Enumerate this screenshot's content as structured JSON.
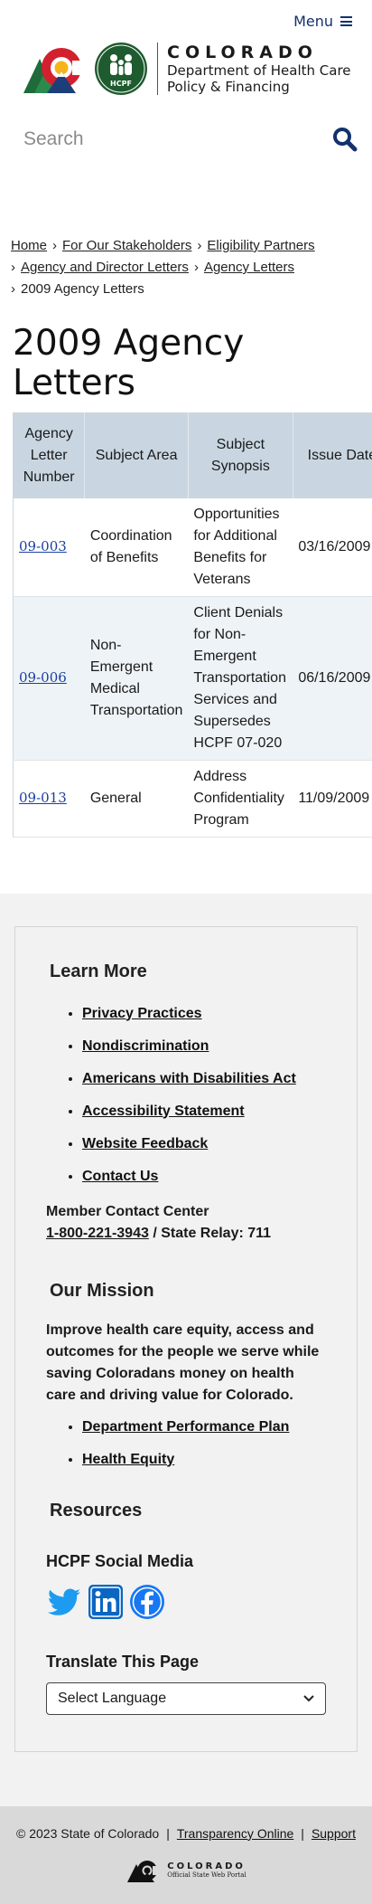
{
  "header": {
    "menu_label": "Menu",
    "agency_state": "COLORADO",
    "agency_name_line1": "Department of Health Care",
    "agency_name_line2": "Policy & Financing",
    "hcpf_badge": "HCPF",
    "search_placeholder": "Search"
  },
  "breadcrumb": [
    {
      "label": "Home",
      "link": true
    },
    {
      "label": "For Our Stakeholders",
      "link": true
    },
    {
      "label": "Eligibility Partners",
      "link": true
    },
    {
      "label": "Agency and Director Letters",
      "link": true
    },
    {
      "label": "Agency Letters",
      "link": true
    },
    {
      "label": "2009 Agency Letters",
      "link": false
    }
  ],
  "page_title": "2009 Agency Letters",
  "table": {
    "headers": [
      "Agency Letter Number",
      "Subject Area",
      "Subject Synopsis",
      "Issue Date"
    ],
    "rows": [
      {
        "number": "09-003",
        "area": "Coordination of Benefits",
        "synopsis": "Opportunities for Additional Benefits for Veterans",
        "date": "03/16/2009"
      },
      {
        "number": "09-006",
        "area": "Non-Emergent Medical Transportation",
        "synopsis": "Client Denials for Non-Emergent Transportation Services and Supersedes HCPF 07-020",
        "date": "06/16/2009"
      },
      {
        "number": "09-013",
        "area": "General",
        "synopsis": "Address Confidentiality Program",
        "date": "11/09/2009"
      }
    ]
  },
  "footer": {
    "learn_more_heading": "Learn More",
    "learn_more_links": [
      "Privacy Practices",
      "Nondiscrimination",
      "Americans with Disabilities Act",
      "Accessibility Statement",
      "Website Feedback",
      "Contact Us"
    ],
    "member_contact_label": "Member Contact Center",
    "member_phone": "1-800-221-3943",
    "state_relay": " / State Relay: 711",
    "mission_heading": "Our Mission",
    "mission_text": "Improve health care equity, access and outcomes for the people we serve while saving Coloradans money on health care and driving value for Colorado.",
    "mission_links": [
      "Department Performance Plan",
      "Health Equity"
    ],
    "resources_heading": "Resources",
    "social_heading": "HCPF Social Media",
    "social_icons": [
      "twitter-icon",
      "linkedin-icon",
      "facebook-icon"
    ],
    "translate_heading": "Translate This Page",
    "language_select": "Select Language",
    "copyright": "© 2023 State of Colorado",
    "transparency_link": "Transparency Online",
    "support_link": "Support",
    "portal_state": "COLORADO",
    "portal_sub": "Official State Web Portal"
  },
  "colors": {
    "brand_navy": "#12316e",
    "table_header": "#c9d6e1",
    "table_alt_row": "#eef3f7",
    "footer_bg": "#f2f2f2",
    "bottom_bar": "#d9d9d9",
    "twitter": "#1d9bf0",
    "linkedin": "#0a66c2",
    "facebook": "#1877f2"
  }
}
